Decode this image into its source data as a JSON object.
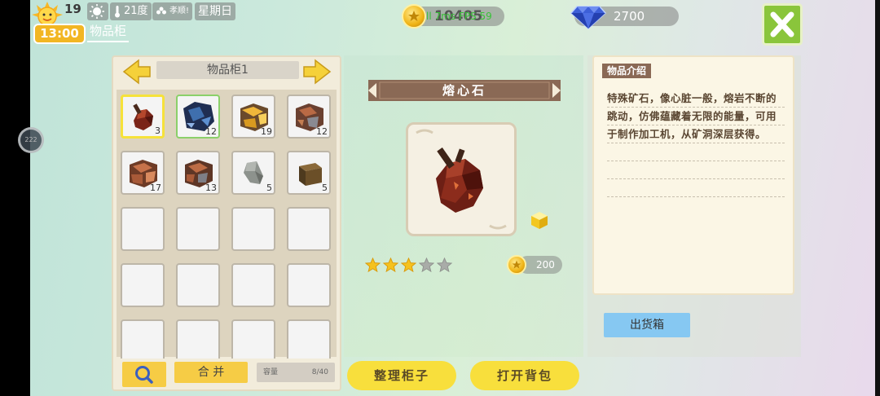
{
  "status_bar": {
    "day": "19",
    "time": "13:00",
    "temperature": "21度",
    "status_text": "孝顺!",
    "weekday": "星期日"
  },
  "page_tab": "物品柜",
  "currency": {
    "coins": "10405",
    "fps_overlay": "ll 7ms FPS 59",
    "gems": "2700"
  },
  "side_bubble": "222",
  "inventory": {
    "title": "物品柜1",
    "slots": [
      {
        "icon": "red-ore-icon",
        "count": "3",
        "selected": true
      },
      {
        "icon": "blue-ore-icon",
        "count": "12"
      },
      {
        "icon": "gold-ore-icon",
        "count": "19"
      },
      {
        "icon": "iron-ore-icon",
        "count": "12"
      },
      {
        "icon": "copper-ore-icon",
        "count": "17"
      },
      {
        "icon": "copper-iron-ore-icon",
        "count": "13"
      },
      {
        "icon": "stone-icon",
        "count": "5"
      },
      {
        "icon": "dirt-block-icon",
        "count": "5"
      }
    ],
    "merge_label": "合 并",
    "capacity_label": "容量",
    "capacity_value": "8/40"
  },
  "detail": {
    "name": "熔心石",
    "stars_filled": 3,
    "stars_total": 5,
    "price": "200"
  },
  "description": {
    "tag": "物品介绍",
    "text": "特殊矿石，像心脏一般，熔岩不断的跳动，仿佛蕴藏着无限的能量，可用于制作加工机，从矿洞深层获得。",
    "ship_button": "出货箱"
  },
  "buttons": {
    "organize": "整理柜子",
    "open_backpack": "打开背包"
  },
  "colors": {
    "accent_yellow": "#f8df3c",
    "brown_banner": "#8a6955",
    "close_green": "#8ac53b",
    "ship_blue": "#86c8f2"
  }
}
